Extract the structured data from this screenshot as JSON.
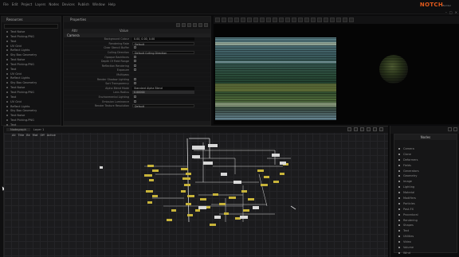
{
  "app": {
    "logo_main": "NOTCH",
    "logo_sub": "Builder"
  },
  "menubar": {
    "items": [
      "File",
      "Edit",
      "Project",
      "Layers",
      "Nodes",
      "Devices",
      "Publish",
      "Window",
      "Help"
    ]
  },
  "resources": {
    "title": "Resources",
    "items": [
      "Text Noise",
      "Text Picking.PNG",
      "Text",
      "UV Grid",
      "Reflect Lights",
      "Sky Box Geometry",
      "Text Noise",
      "Text Picking.PNG",
      "Text",
      "UV Grid",
      "Reflect Lights",
      "Sky Box Geometry",
      "Text Noise",
      "Text Picking.PNG",
      "Text",
      "UV Grid",
      "Reflect Lights",
      "Sky Box Geometry",
      "Text Noise",
      "Text Picking.PNG",
      "Text"
    ]
  },
  "properties": {
    "title": "Properties",
    "col_attr": "Attr",
    "col_value": "Value",
    "section": "Camera",
    "rows": [
      {
        "label": "Background Colour",
        "value": "0.00, 0.00, 0.00",
        "kind": "dark"
      },
      {
        "label": "Rendering Rate",
        "value": "Default",
        "kind": "box"
      },
      {
        "label": "Clear Stencil Buffer",
        "value": "",
        "kind": "cb"
      },
      {
        "label": "Culling Direction",
        "value": "Default Culling Direction",
        "kind": "box"
      },
      {
        "label": "Opaque Backfaces",
        "value": "",
        "kind": "cb"
      },
      {
        "label": "Depth Of Field Range",
        "value": "",
        "kind": "cb"
      },
      {
        "label": "Reflection Rendering",
        "value": "",
        "kind": "cb"
      },
      {
        "label": "Exposure",
        "value": "",
        "kind": "cb"
      },
      {
        "label": "Multipass",
        "value": "",
        "kind": "none"
      },
      {
        "label": "Render Shadow Lighting",
        "value": "",
        "kind": "cb"
      },
      {
        "label": "Sort Transparency",
        "value": "",
        "kind": "cb"
      },
      {
        "label": "Alpha Blend Mode",
        "value": "Standard Alpha Blend",
        "kind": "dark"
      },
      {
        "label": "Lens Radius",
        "value": "0.00000",
        "kind": "bar"
      },
      {
        "label": "Environmental Lighting",
        "value": "",
        "kind": "cb"
      },
      {
        "label": "Emission Luminance",
        "value": "",
        "kind": "cb"
      },
      {
        "label": "Render Texture Resolution",
        "value": "Default",
        "kind": "box"
      }
    ]
  },
  "graph": {
    "tab_label": "Nodegraph",
    "tabs": [
      "Nodegraph",
      "Layer 1"
    ],
    "toolbar": [
      "All",
      "Title",
      "Bk",
      "Mat",
      "Off",
      "Active"
    ],
    "nodes_label": "Nodes"
  },
  "nodes_panel": {
    "title": "Nodes",
    "items": [
      "Camera",
      "Clone",
      "Deformers",
      "Fields",
      "Generators",
      "Geometry",
      "Image",
      "Lighting",
      "Material",
      "Modifiers",
      "Particles",
      "Post-FX",
      "Procedural",
      "Rendering",
      "Shapes",
      "Text",
      "Utilities",
      "Video",
      "Volume",
      "Wind",
      "Misc",
      "Cache"
    ]
  },
  "colors": {
    "accent": "#e25a1c",
    "node_yellow": "#c8b43a",
    "wire_white": "#d6d6d6",
    "grid_bg": "#1b1b1d"
  }
}
